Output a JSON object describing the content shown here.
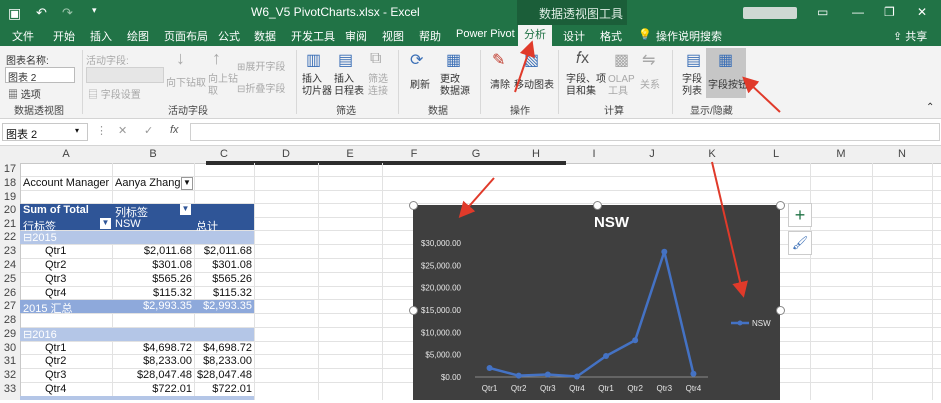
{
  "title": {
    "filename": "W6_V5 PivotCharts.xlsx  -  Excel",
    "tools_context": "数据透视图工具",
    "account_blur": "",
    "window_controls": [
      "restore-icon",
      "minimize-icon",
      "maximize-icon",
      "close-icon"
    ]
  },
  "tabs": [
    "文件",
    "开始",
    "插入",
    "绘图",
    "页面布局",
    "公式",
    "数据",
    "开发工具",
    "审阅",
    "视图",
    "帮助",
    "Power Pivot",
    "分析",
    "设计",
    "格式"
  ],
  "active_tab": "分析",
  "tell_me": "操作说明搜索",
  "share": "共享",
  "ribbon": {
    "chart_name_label": "图表名称:",
    "chart_name_value": "图表 2",
    "options_label": "选项",
    "group_pivotchart": "数据透视图",
    "active_field_label": "活动字段:",
    "field_settings": "字段设置",
    "drill_down": "向下钻取",
    "drill_up": "向上钻\n取",
    "expand_field": "展开字段",
    "collapse_field": "折叠字段",
    "group_active_field": "活动字段",
    "insert_slicer": "插入\n切片器",
    "insert_timeline": "插入\n日程表",
    "filter_connections": "筛选\n连接",
    "group_filter": "筛选",
    "refresh": "刷新",
    "change_source": "更改\n数据源",
    "group_data": "数据",
    "clear": "清除",
    "move_chart": "移动图表",
    "group_actions": "操作",
    "fields_items": "字段、项\n目和集",
    "olap_tools": "OLAP\n工具",
    "relationships": "关系",
    "group_calc": "计算",
    "field_list": "字段\n列表",
    "field_buttons": "字段按钮",
    "group_show_hide": "显示/隐藏"
  },
  "formula_bar": {
    "name_box": "图表 2",
    "cancel": "✕",
    "enter": "✓",
    "fx": "fx",
    "formula": ""
  },
  "columns": [
    "A",
    "B",
    "C",
    "D",
    "E",
    "F",
    "G",
    "H",
    "I",
    "J",
    "K",
    "L",
    "M",
    "N"
  ],
  "rows": [
    "17",
    "18",
    "19",
    "20",
    "21",
    "22",
    "23",
    "24",
    "25",
    "26",
    "27",
    "28",
    "29",
    "30",
    "31",
    "32",
    "33"
  ],
  "pivot": {
    "filter_label": "Account Manager",
    "filter_value": "Aanya Zhang",
    "sum_label": "Sum of Total",
    "col_label": "列标签",
    "row_label": "行标签",
    "nsw": "NSW",
    "total": "总计",
    "year1": "2015",
    "year1_rows": [
      {
        "q": "Qtr1",
        "nsw": "$2,011.68",
        "total": "$2,011.68"
      },
      {
        "q": "Qtr2",
        "nsw": "$301.08",
        "total": "$301.08"
      },
      {
        "q": "Qtr3",
        "nsw": "$565.26",
        "total": "$565.26"
      },
      {
        "q": "Qtr4",
        "nsw": "$115.32",
        "total": "$115.32"
      }
    ],
    "year1_sub": {
      "label": "2015 汇总",
      "nsw": "$2,993.35",
      "total": "$2,993.35"
    },
    "year2": "2016",
    "year2_rows": [
      {
        "q": "Qtr1",
        "nsw": "$4,698.72",
        "total": "$4,698.72"
      },
      {
        "q": "Qtr2",
        "nsw": "$8,233.00",
        "total": "$8,233.00"
      },
      {
        "q": "Qtr3",
        "nsw": "$28,047.48",
        "total": "$28,047.48"
      },
      {
        "q": "Qtr4",
        "nsw": "$722.01",
        "total": "$722.01"
      }
    ]
  },
  "colors": {
    "excel_green": "#217346",
    "pivot_header": "#2f5597",
    "pivot_light": "#b4c6e7",
    "chart_bg": "#404040",
    "series": "#4472c4",
    "arrow": "#e03a2a"
  },
  "chart_data": {
    "type": "line",
    "title": "NSW",
    "categories": [
      "Qtr1",
      "Qtr2",
      "Qtr3",
      "Qtr4",
      "Qtr1",
      "Qtr2",
      "Qtr3",
      "Qtr4"
    ],
    "series": [
      {
        "name": "NSW",
        "values": [
          2011.68,
          301.08,
          565.26,
          115.32,
          4698.72,
          8233.0,
          28047.48,
          722.01
        ]
      }
    ],
    "ylim": [
      0,
      30000
    ],
    "yticks": [
      "$0.00",
      "$5,000.00",
      "$10,000.00",
      "$15,000.00",
      "$20,000.00",
      "$25,000.00",
      "$30,000.00"
    ],
    "legend": "right",
    "grid": false
  }
}
